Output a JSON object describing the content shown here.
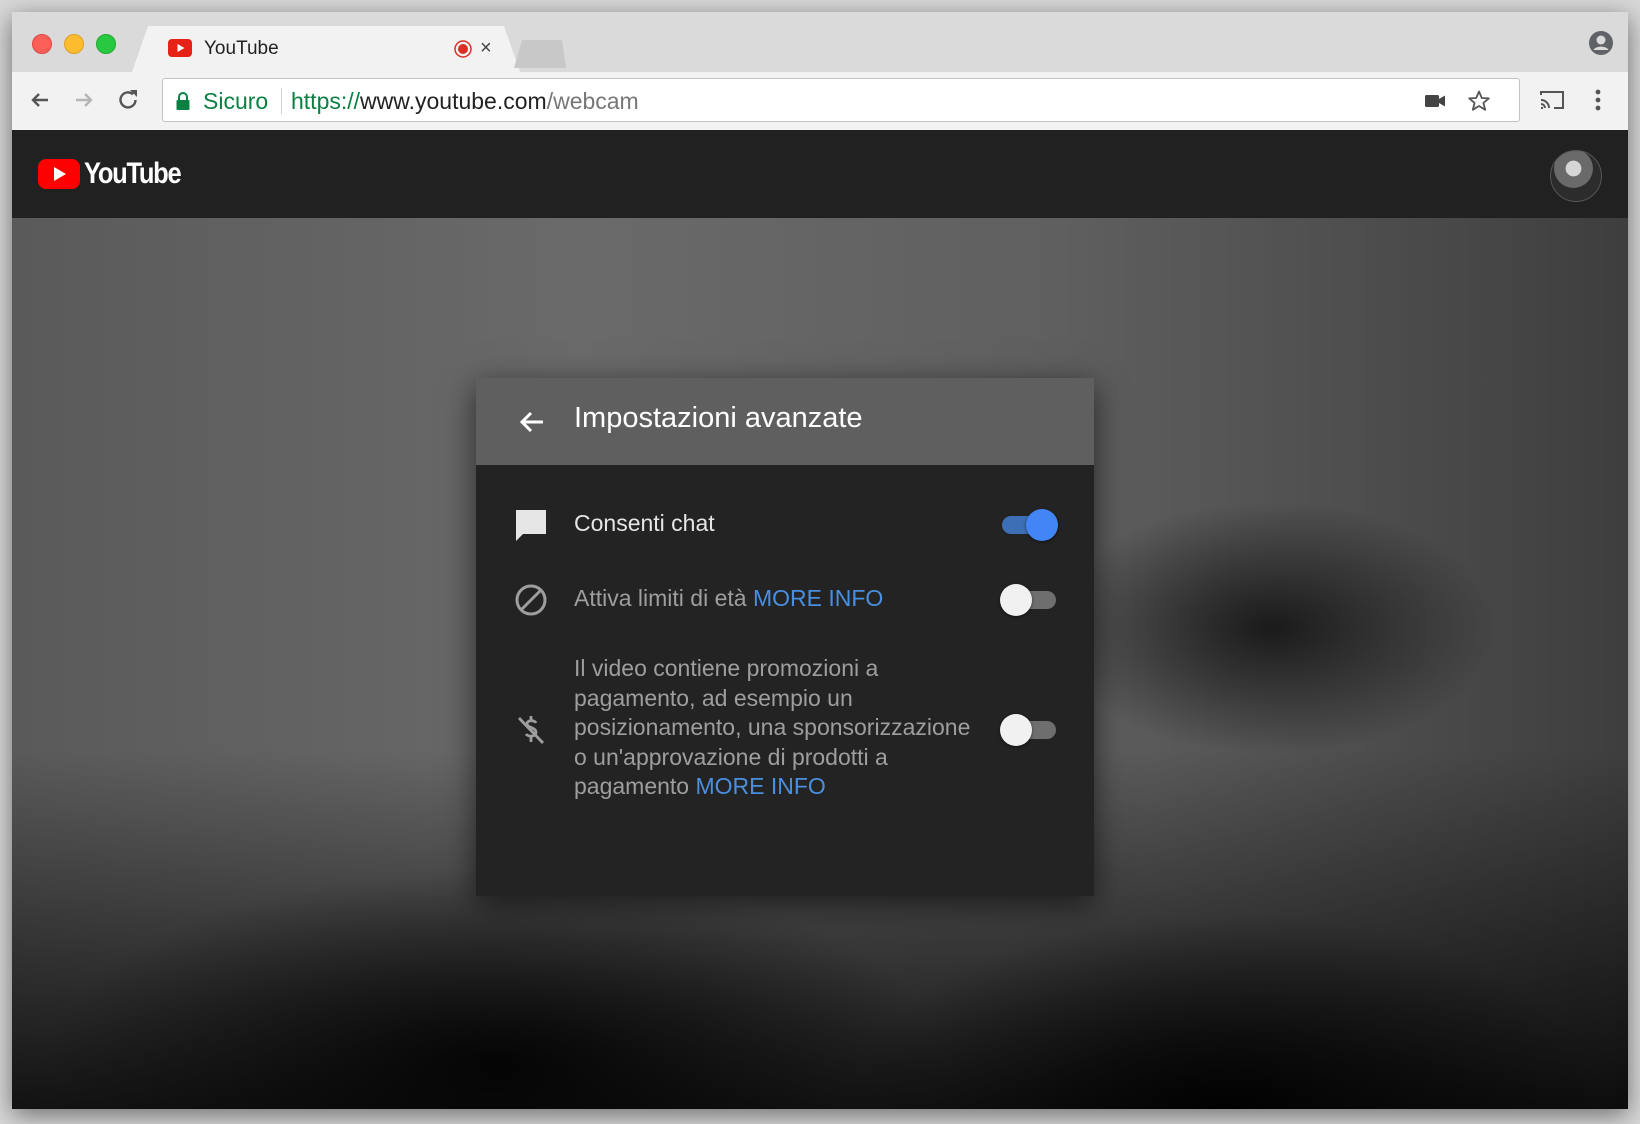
{
  "browser": {
    "tab": {
      "title": "YouTube",
      "close_glyph": "×",
      "favicon": "youtube-icon",
      "indicator": "recording-icon"
    },
    "toolbar": {
      "secure_label": "Sicuro",
      "url_scheme": "https://",
      "url_host": "www.youtube.com",
      "url_path": "/webcam",
      "icons": [
        "back-icon",
        "forward-icon",
        "reload-icon",
        "camera-icon",
        "star-icon",
        "cast-icon",
        "menu-icon"
      ]
    },
    "colors": {
      "secure_green": "#0b8043",
      "link_blue": "#4a8fdf",
      "toggle_on": "#4285f4"
    }
  },
  "youtube": {
    "logo_text": "YouTube"
  },
  "dialog": {
    "title": "Impostazioni avanzate",
    "rows": [
      {
        "icon": "chat-icon",
        "label": "Consenti chat",
        "enabled": true
      },
      {
        "icon": "block-icon",
        "label": "Attiva limiti di età ",
        "link": "MORE INFO",
        "enabled": false
      },
      {
        "icon": "no-money-icon",
        "label": "Il video contiene promozioni a pagamento, ad esempio un posizionamento, una sponsorizzazione o un'approvazione di prodotti a pagamento ",
        "link": "MORE INFO",
        "enabled": false
      }
    ]
  }
}
